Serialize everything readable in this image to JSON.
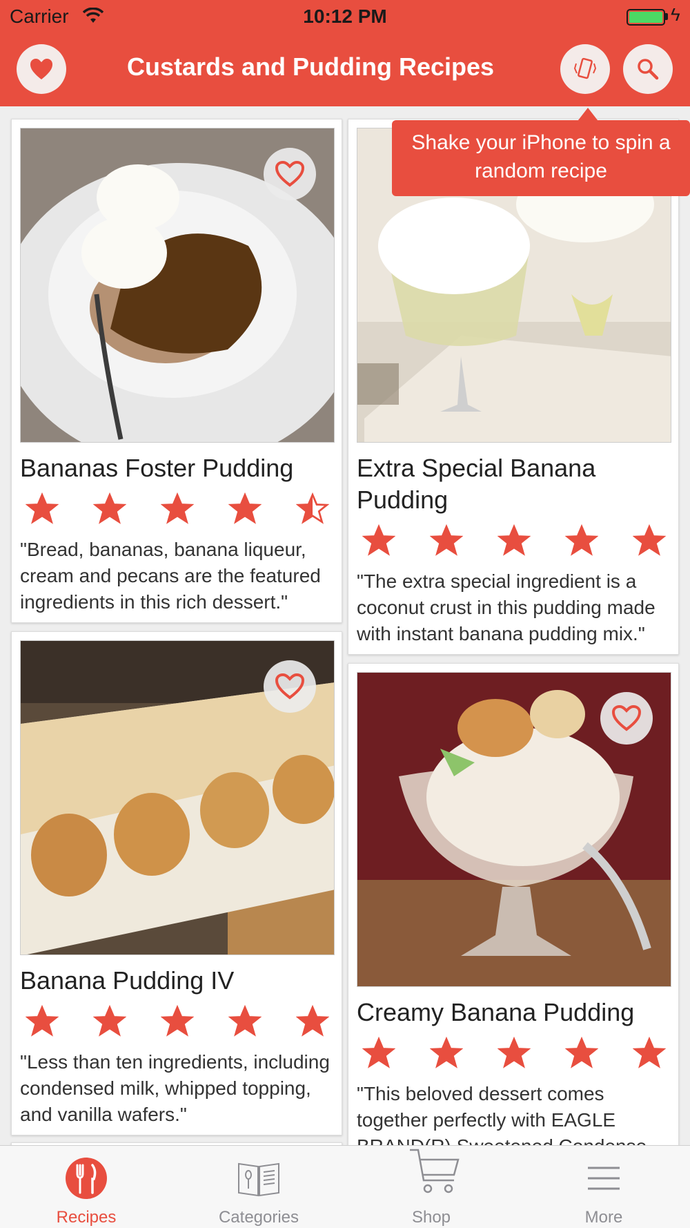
{
  "status": {
    "carrier": "Carrier",
    "time": "10:12 PM"
  },
  "nav": {
    "title": "Custards and Pudding Recipes"
  },
  "tooltip": {
    "text": "Shake your iPhone to spin a random recipe"
  },
  "colors": {
    "accent": "#e84e3f",
    "star": "#e84e3f",
    "battery": "#4cd964"
  },
  "recipes": [
    {
      "title": "Bananas Foster Pudding",
      "rating": 4.5,
      "description": "\"Bread, bananas, banana liqueur, cream and pecans are the featured ingredients in this rich dessert.\""
    },
    {
      "title": "Extra Special Banana Pudding",
      "rating": 5,
      "description": "\"The extra special ingredient is a coconut crust in this pudding made with instant banana pudding mix.\""
    },
    {
      "title": "Banana Pudding IV",
      "rating": 5,
      "description": "\"Less than ten ingredients, including condensed milk, whipped topping, and vanilla wafers.\""
    },
    {
      "title": "Creamy Banana Pudding",
      "rating": 5,
      "description": "\"This beloved dessert comes together perfectly with EAGLE BRAND(R) Sweetened Condensed Milk.\""
    }
  ],
  "tabs": [
    {
      "label": "Recipes",
      "icon": "fork-knife-icon",
      "active": true
    },
    {
      "label": "Categories",
      "icon": "book-icon",
      "active": false
    },
    {
      "label": "Shop",
      "icon": "cart-icon",
      "active": false
    },
    {
      "label": "More",
      "icon": "menu-icon",
      "active": false
    }
  ]
}
